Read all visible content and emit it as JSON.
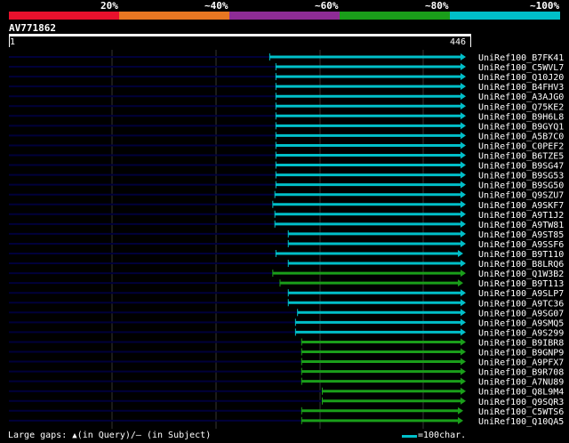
{
  "legend": {
    "labels": [
      "20%",
      "~40%",
      "~60%",
      "~80%",
      "~100%"
    ],
    "colors": [
      "#e8112d",
      "#e87722",
      "#8e2c96",
      "#1a9e1a",
      "#00bfc9"
    ]
  },
  "query": {
    "id": "AV771862",
    "start": "1",
    "end": "446",
    "length": 446
  },
  "colors": {
    "teal": "#00bfc9",
    "green": "#1a9e1a",
    "navy": "#00003a",
    "grid": "#333333"
  },
  "hits": [
    {
      "label": "UniRef100_B7FK41",
      "start": 254,
      "color": "teal",
      "full_end": true
    },
    {
      "label": "UniRef100_C5WVL7",
      "start": 260,
      "color": "teal",
      "full_end": true
    },
    {
      "label": "UniRef100_Q10J20",
      "start": 260,
      "color": "teal",
      "full_end": true
    },
    {
      "label": "UniRef100_B4FHV3",
      "start": 260,
      "color": "teal",
      "full_end": true
    },
    {
      "label": "UniRef100_A3AJG0",
      "start": 260,
      "color": "teal",
      "full_end": true
    },
    {
      "label": "UniRef100_Q75KE2",
      "start": 260,
      "color": "teal",
      "full_end": true
    },
    {
      "label": "UniRef100_B9H6L8",
      "start": 260,
      "color": "teal",
      "full_end": true
    },
    {
      "label": "UniRef100_B9GYQ1",
      "start": 260,
      "color": "teal",
      "full_end": true
    },
    {
      "label": "UniRef100_A5B7C0",
      "start": 260,
      "color": "teal",
      "full_end": true
    },
    {
      "label": "UniRef100_C0PEF2",
      "start": 260,
      "color": "teal",
      "full_end": true
    },
    {
      "label": "UniRef100_B6TZE5",
      "start": 260,
      "color": "teal",
      "full_end": true
    },
    {
      "label": "UniRef100_B9SG47",
      "start": 260,
      "color": "teal",
      "full_end": true
    },
    {
      "label": "UniRef100_B9SG53",
      "start": 260,
      "color": "teal",
      "full_end": true
    },
    {
      "label": "UniRef100_B9SG50",
      "start": 260,
      "color": "teal",
      "full_end": true
    },
    {
      "label": "UniRef100_Q9SZU7",
      "start": 259,
      "color": "teal",
      "full_end": true
    },
    {
      "label": "UniRef100_A9SKF7",
      "start": 257,
      "color": "teal",
      "full_end": true
    },
    {
      "label": "UniRef100_A9T1J2",
      "start": 259,
      "color": "teal",
      "full_end": true
    },
    {
      "label": "UniRef100_A9TW81",
      "start": 259,
      "color": "teal",
      "full_end": true
    },
    {
      "label": "UniRef100_A9ST85",
      "start": 272,
      "color": "teal",
      "full_end": true
    },
    {
      "label": "UniRef100_A9SSF6",
      "start": 272,
      "color": "teal",
      "full_end": true
    },
    {
      "label": "UniRef100_B9T110",
      "start": 260,
      "color": "teal",
      "full_end": false
    },
    {
      "label": "UniRef100_B8LRQ6",
      "start": 272,
      "color": "teal",
      "full_end": true
    },
    {
      "label": "UniRef100_Q1W3B2",
      "start": 257,
      "color": "green",
      "full_end": true
    },
    {
      "label": "UniRef100_B9T113",
      "start": 264,
      "color": "green",
      "full_end": false
    },
    {
      "label": "UniRef100_A9SLP7",
      "start": 272,
      "color": "teal",
      "full_end": true
    },
    {
      "label": "UniRef100_A9TC36",
      "start": 272,
      "color": "teal",
      "full_end": true
    },
    {
      "label": "UniRef100_A9SG07",
      "start": 281,
      "color": "teal",
      "full_end": true
    },
    {
      "label": "UniRef100_A9SMQ5",
      "start": 279,
      "color": "teal",
      "full_end": true
    },
    {
      "label": "UniRef100_A9S299",
      "start": 279,
      "color": "teal",
      "full_end": true
    },
    {
      "label": "UniRef100_B9IBR8",
      "start": 285,
      "color": "green",
      "full_end": true
    },
    {
      "label": "UniRef100_B9GNP9",
      "start": 285,
      "color": "green",
      "full_end": true
    },
    {
      "label": "UniRef100_A9PFX7",
      "start": 285,
      "color": "green",
      "full_end": true
    },
    {
      "label": "UniRef100_B9R708",
      "start": 285,
      "color": "green",
      "full_end": true
    },
    {
      "label": "UniRef100_A7NU89",
      "start": 285,
      "color": "green",
      "full_end": true
    },
    {
      "label": "UniRef100_Q8L9M4",
      "start": 305,
      "color": "green",
      "full_end": true
    },
    {
      "label": "UniRef100_Q9SQR3",
      "start": 305,
      "color": "green",
      "full_end": true
    },
    {
      "label": "UniRef100_C5WTS6",
      "start": 285,
      "color": "green",
      "full_end": false
    },
    {
      "label": "UniRef100_Q10QA5",
      "start": 285,
      "color": "green",
      "full_end": false
    }
  ],
  "footer": {
    "gaps_label": "Large gaps:",
    "query_gap_marker": "▲",
    "query_gap_text": "(in Query)/",
    "subject_gap_marker": "—",
    "subject_gap_text": " (in Subject)",
    "scale_text": "=100char."
  }
}
